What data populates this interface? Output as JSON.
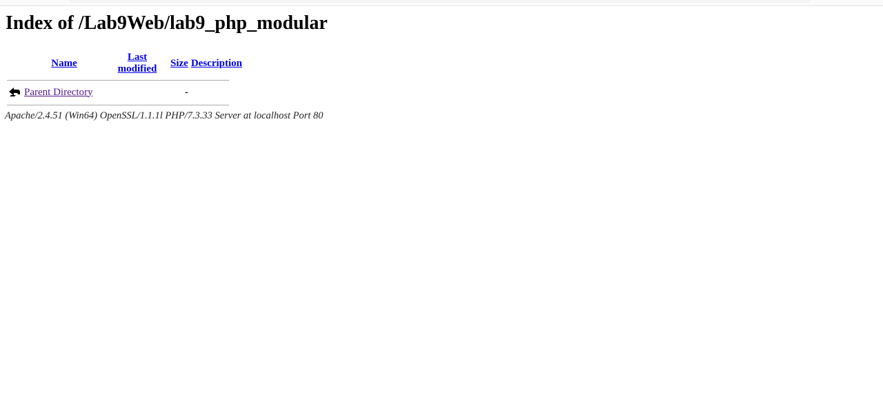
{
  "page": {
    "title": "Index of /Lab9Web/lab9_php_modular"
  },
  "table": {
    "headers": {
      "name": "Name",
      "last_modified": "Last modified",
      "size": "Size",
      "description": "Description"
    },
    "rows": [
      {
        "icon": "back-arrow-icon",
        "name": "Parent Directory",
        "last_modified": "",
        "size": "-",
        "description": ""
      }
    ]
  },
  "footer": {
    "address": "Apache/2.4.51 (Win64) OpenSSL/1.1.1l PHP/7.3.33 Server at localhost Port 80"
  },
  "colors": {
    "link": "#0000ee",
    "visited_link": "#551a8b",
    "rule": "#aaaaaa"
  }
}
